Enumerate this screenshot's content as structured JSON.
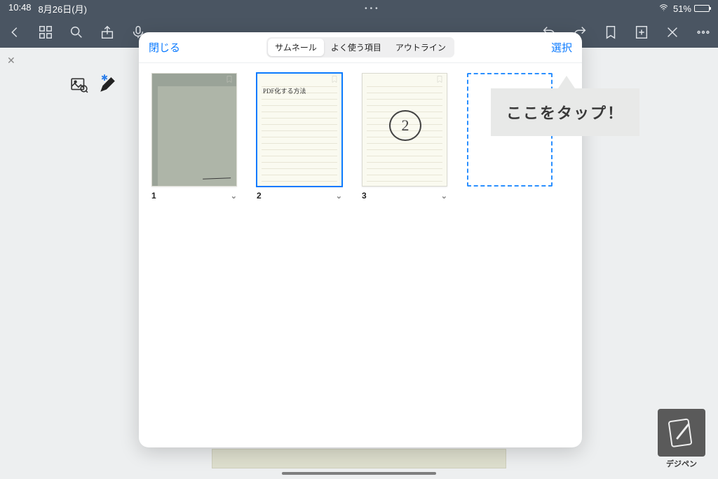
{
  "status": {
    "time": "10:48",
    "date": "8月26日(月)",
    "battery_pct": "51%"
  },
  "modal": {
    "close": "閉じる",
    "select": "選択",
    "segments": {
      "thumb": "サムネール",
      "fav": "よく使う項目",
      "outline": "アウトライン"
    }
  },
  "pages": {
    "p1": "1",
    "p2": "2",
    "p3": "3",
    "p2_text": "PDF化する方法"
  },
  "callout": "ここをタップ！",
  "logo": "デジペン"
}
